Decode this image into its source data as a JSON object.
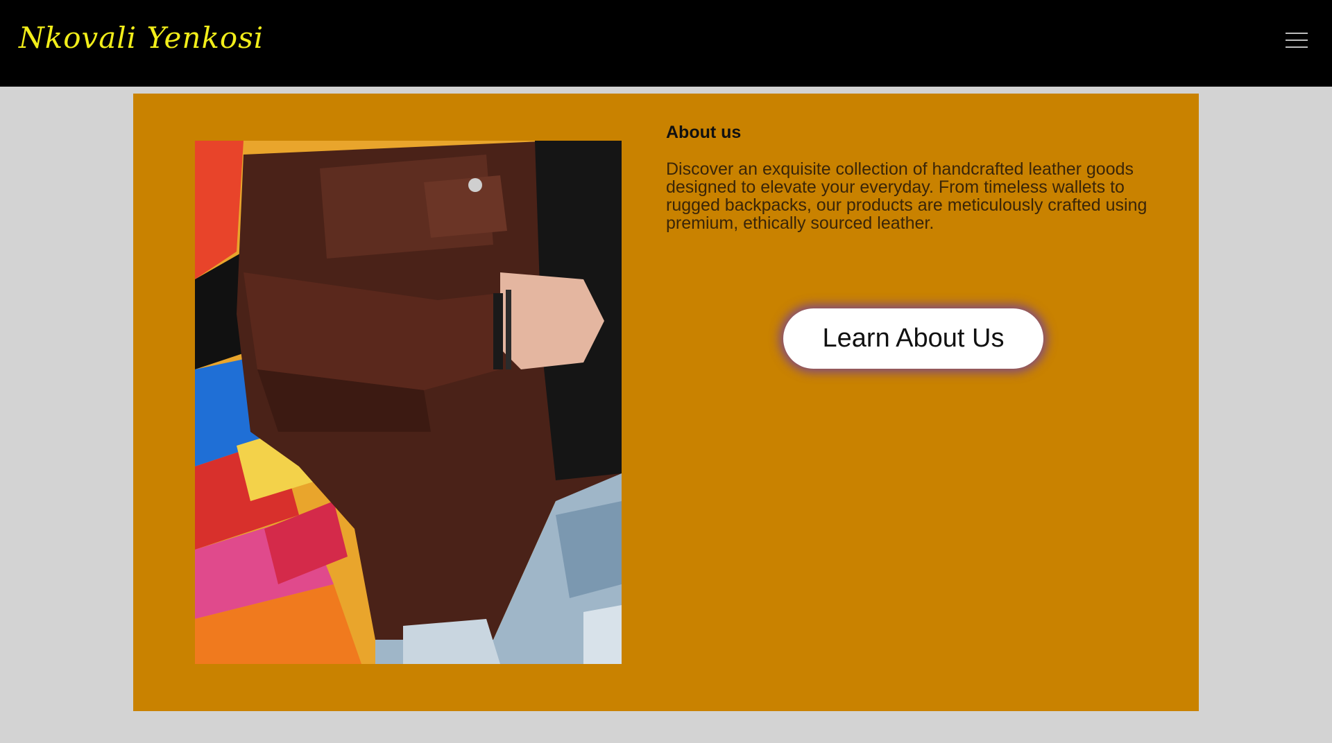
{
  "header": {
    "brand": "Nkovali Yenkosi",
    "menu_icon": "hamburger-menu-icon"
  },
  "about": {
    "title": "About us",
    "description": "Discover an exquisite collection of handcrafted leather goods designed to elevate your everyday. From timeless wallets to rugged backpacks, our products are meticulously crafted using premium, ethically sourced leather.",
    "button_label": "Learn About Us"
  },
  "colors": {
    "header_bg": "#000000",
    "brand_text": "#f2ee1a",
    "page_bg": "#d3d3d3",
    "card_bg": "#c98200",
    "button_bg": "#ffffff",
    "button_glow": "#6e3ca0"
  },
  "image": {
    "subject": "person in brown leather jacket and ripped jeans in front of colorful graffiti wall"
  }
}
